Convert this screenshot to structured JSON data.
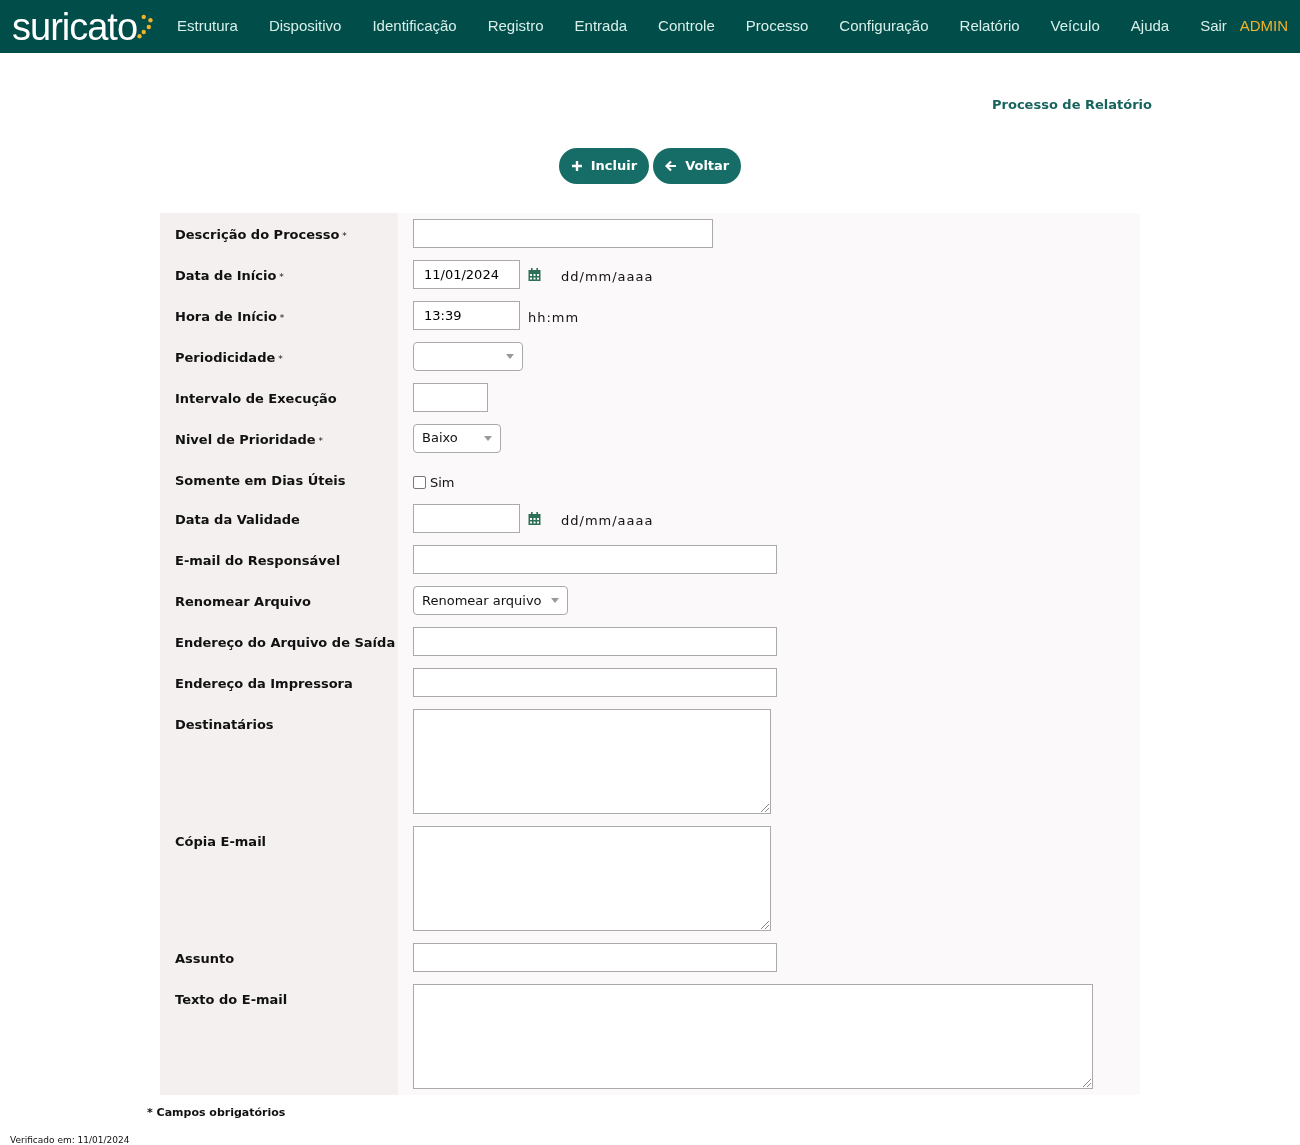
{
  "logo": {
    "text": "suricato"
  },
  "nav": {
    "items": [
      "Estrutura",
      "Dispositivo",
      "Identificação",
      "Registro",
      "Entrada",
      "Controle",
      "Processo",
      "Configuração",
      "Relatório",
      "Veículo",
      "Ajuda",
      "Sair"
    ],
    "user": "ADMIN"
  },
  "page_title": "Processo de Relatório",
  "buttons": [
    {
      "label": "Incluir",
      "kind": "add"
    },
    {
      "label": "Voltar",
      "kind": "back"
    }
  ],
  "fields": [
    {
      "label": "Descrição do Processo",
      "required_mark": "*",
      "kind": "text"
    },
    {
      "label": "Data de Início",
      "required_mark": "*",
      "kind": "date",
      "value": "11/01/2024",
      "hint": "dd/mm/aaaa"
    },
    {
      "label": "Hora de Início",
      "required_mark": "*",
      "kind": "time",
      "value": "13:39",
      "hint": "hh:mm"
    },
    {
      "label": "Periodicidade",
      "required_mark": "*",
      "kind": "select"
    },
    {
      "label": "Intervalo de Execução",
      "kind": "text"
    },
    {
      "label": "Nivel de Prioridade",
      "required_mark": "*",
      "kind": "select",
      "value": "Baixo"
    },
    {
      "label": "Somente em Dias Úteis",
      "kind": "checkbox",
      "option": "Sim",
      "checked": false
    },
    {
      "label": "Data da Validade",
      "kind": "date",
      "hint": "dd/mm/aaaa"
    },
    {
      "label": "E-mail do Responsável",
      "kind": "text"
    },
    {
      "label": "Renomear Arquivo",
      "kind": "select",
      "value": "Renomear arquivo"
    },
    {
      "label": "Endereço do Arquivo de Saída",
      "kind": "text"
    },
    {
      "label": "Endereço da Impressora",
      "kind": "text"
    },
    {
      "label": "Destinatários",
      "kind": "textarea"
    },
    {
      "label": "Cópia E-mail",
      "kind": "textarea"
    },
    {
      "label": "Assunto",
      "kind": "text"
    },
    {
      "label": "Texto do E-mail",
      "kind": "textarea"
    }
  ],
  "footnote": "* Campos obrigatórios",
  "verified": "Verificado em: 11/01/2024"
}
